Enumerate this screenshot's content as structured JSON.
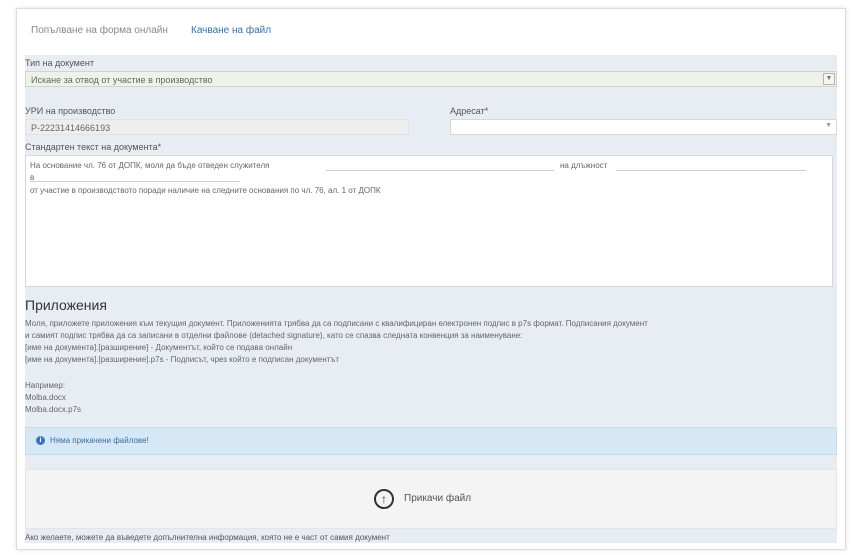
{
  "tabs": [
    {
      "label": "Попълване на форма онлайн",
      "active": false
    },
    {
      "label": "Качване на файл",
      "active": true
    }
  ],
  "form": {
    "doc_type_label": "Тип на документ",
    "doc_type_value": "Искане за отвод от участие в производство",
    "reg_label": "УРИ на производство",
    "reg_value": "Р-22231414666193",
    "addr_label": "Адресат*",
    "addr_value": "",
    "std_label": "Стандартен текст на документа*",
    "std_line1": "На основание чл. 76 от ДОПК, моля да бъде отведен служителя",
    "std_line1_tail": "на длъжност",
    "std_line2": "в",
    "std_line3": "от участие в производството поради наличие на следните основания по чл. 76, ал. 1 от ДОПК"
  },
  "attachments": {
    "title": "Приложения",
    "p1": "Моля, приложете приложения към текущия документ. Приложенията трябва да са подписани с квалифициран електронен подпис в p7s формат. Подписания документ",
    "p2": "и самият подпис трябва да са записани в отделни файлове (detached signature), като се спазва следната конвенция за наименуване:",
    "p3": "[име на документа].[разширение] - Документът, който се подава онлайн",
    "p4": "[име на документа].[разширение].p7s - Подписът, чрез който е подписан документът",
    "example_label": "Например:",
    "example1": "Molba.docx",
    "example2": "Molba.docx.p7s",
    "info_icon": "info-icon",
    "info_link": "Няма прикачени файлове!",
    "upload_icon": "upload-circle-icon",
    "upload_label": "Прикачи файл",
    "footer": "Ако желаете, можете да въведете допълнителна информация, която не е част от самия документ"
  },
  "colors": {
    "accent": "#3a6ea5",
    "panel_bg": "#e8edf3",
    "info_bg": "#d6e8f5"
  }
}
